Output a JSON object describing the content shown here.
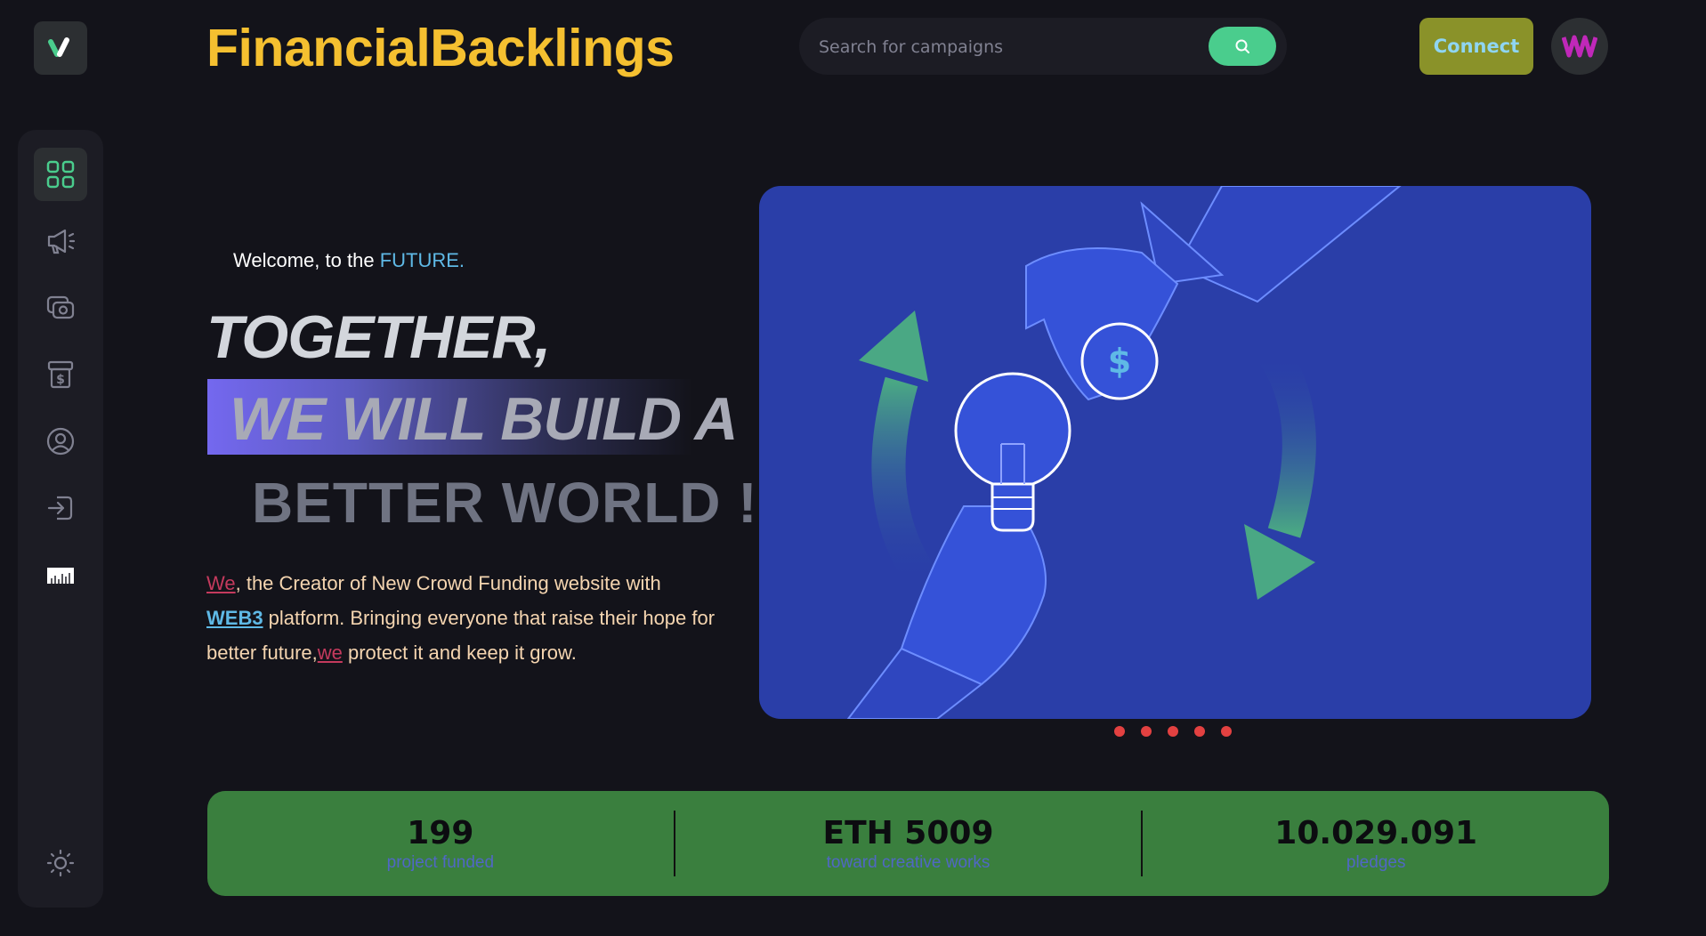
{
  "brand": {
    "name": "FinancialBacklings"
  },
  "search": {
    "placeholder": "Search for campaigns"
  },
  "header": {
    "connect_label": "Connect"
  },
  "sidebar": {
    "items": [
      {
        "icon": "dashboard-grid-icon",
        "active": true
      },
      {
        "icon": "megaphone-icon",
        "active": false
      },
      {
        "icon": "payment-icon",
        "active": false
      },
      {
        "icon": "withdraw-icon",
        "active": false
      },
      {
        "icon": "profile-icon",
        "active": false
      },
      {
        "icon": "logout-icon",
        "active": false
      },
      {
        "icon": "chart-icon",
        "active": false
      }
    ],
    "theme_icon": "sun-icon"
  },
  "hero": {
    "welcome_prefix": "Welcome, to the",
    "welcome_highlight": "FUTURE.",
    "line1": "TOGETHER,",
    "line2": "WE WILL BUILD A",
    "line3": "BETTER WORLD !",
    "para": {
      "we1": "We",
      "t1": ", the Creator of New Crowd Funding website with",
      "web3": "WEB3",
      "t2": " platform. Bringing everyone that raise their hope for better future,",
      "we2": "we",
      "t3": " protect it and keep it grow."
    }
  },
  "carousel": {
    "slides": 5,
    "dot_color": "#e34141"
  },
  "stats": [
    {
      "value": "199",
      "label": "project funded"
    },
    {
      "value": "ETH 5009",
      "label": "toward creative works"
    },
    {
      "value": "10.029.091",
      "label": "pledges"
    }
  ],
  "colors": {
    "background": "#13131a",
    "brand": "#f5c030",
    "accent_green": "#4acd8d",
    "connect_bg": "#8a9229",
    "stats_bg": "#3a7f3e",
    "hero_bg": "#2a3ea8"
  }
}
